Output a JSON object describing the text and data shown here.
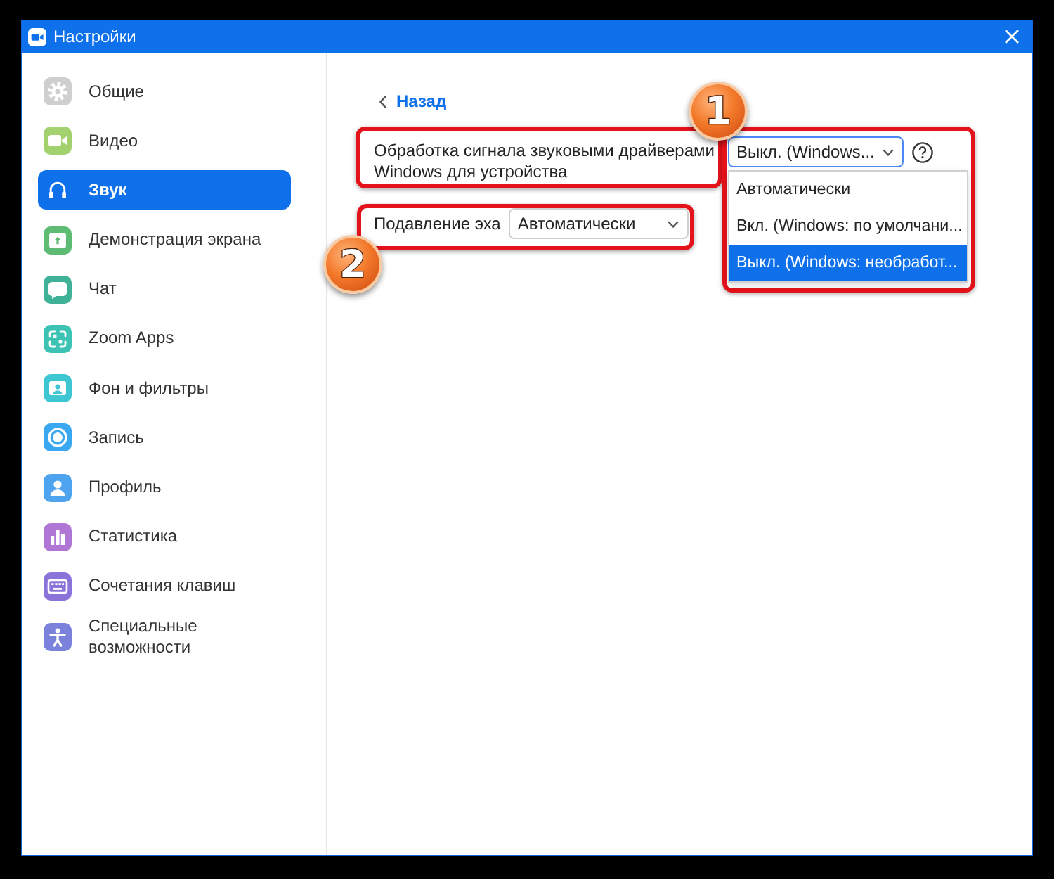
{
  "window": {
    "title": "Настройки"
  },
  "sidebar": {
    "items": [
      {
        "label": "Общие",
        "color": "#cfcfcf",
        "selected": false
      },
      {
        "label": "Видео",
        "color": "#a3d16e",
        "selected": false
      },
      {
        "label": "Звук",
        "selected": true
      },
      {
        "label": "Демонстрация экрана",
        "color": "#5dbb73",
        "selected": false
      },
      {
        "label": "Чат",
        "color": "#3fb197",
        "selected": false
      },
      {
        "label": "Zoom Apps",
        "color": "#3cc3b4",
        "selected": false
      },
      {
        "label": "Фон и фильтры",
        "color": "#3ec7d3",
        "selected": false
      },
      {
        "label": "Запись",
        "color": "#3aa8f0",
        "selected": false
      },
      {
        "label": "Профиль",
        "color": "#4ea4ee",
        "selected": false
      },
      {
        "label": "Статистика",
        "color": "#b076d6",
        "selected": false
      },
      {
        "label": "Сочетания клавиш",
        "color": "#8b74d9",
        "selected": false
      },
      {
        "label": "Специальные возможности",
        "color": "#7a82dc",
        "selected": false
      }
    ]
  },
  "content": {
    "back_link": "Назад",
    "settings": [
      {
        "kind": "select_help",
        "label": "Обработка сигнала звуковыми драйверами Windows для устройства",
        "value": "Выкл. (Windows...",
        "expanded": true,
        "options": [
          {
            "label": "Автоматически",
            "selected": false
          },
          {
            "label": "Вкл. (Windows: по умолчани...",
            "selected": false
          },
          {
            "label": "Выкл. (Windows: необработ...",
            "selected": true
          }
        ],
        "highlighted": true,
        "callout": "1"
      },
      {
        "kind": "select",
        "label": "Подавление эха",
        "value": "Автоматически",
        "expanded": false,
        "highlighted": true,
        "callout": "2"
      }
    ]
  }
}
